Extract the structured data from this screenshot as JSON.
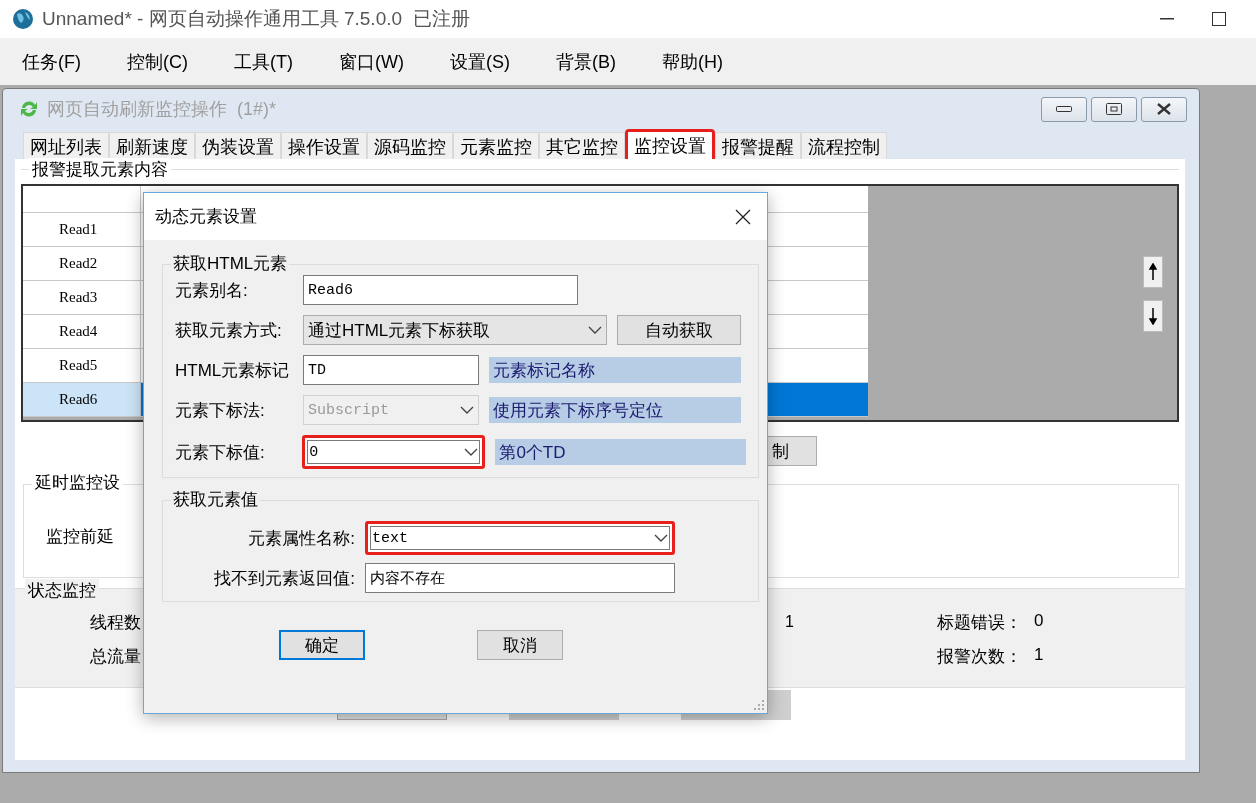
{
  "app": {
    "title": "Unnamed* - 网页自动操作通用工具 7.5.0.0  已注册"
  },
  "menu": [
    "任务(F)",
    "控制(C)",
    "工具(T)",
    "窗口(W)",
    "设置(S)",
    "背景(B)",
    "帮助(H)"
  ],
  "child_window": {
    "title": "网页自动刷新监控操作  (1#)*"
  },
  "tabs": [
    {
      "label": "网址列表",
      "selected": false,
      "highlighted": false
    },
    {
      "label": "刷新速度",
      "selected": false,
      "highlighted": false
    },
    {
      "label": "伪装设置",
      "selected": false,
      "highlighted": false
    },
    {
      "label": "操作设置",
      "selected": false,
      "highlighted": false
    },
    {
      "label": "源码监控",
      "selected": false,
      "highlighted": false
    },
    {
      "label": "元素监控",
      "selected": false,
      "highlighted": false
    },
    {
      "label": "其它监控",
      "selected": false,
      "highlighted": false
    },
    {
      "label": "监控设置",
      "selected": true,
      "highlighted": true
    },
    {
      "label": "报警提醒",
      "selected": false,
      "highlighted": false
    },
    {
      "label": "流程控制",
      "selected": false,
      "highlighted": false
    }
  ],
  "alert_group": {
    "title": "报警提取元素内容",
    "rows": [
      {
        "label": "Read1",
        "selected": false
      },
      {
        "label": "Read2",
        "selected": false
      },
      {
        "label": "Read3",
        "selected": false
      },
      {
        "label": "Read4",
        "selected": false
      },
      {
        "label": "Read5",
        "selected": false
      },
      {
        "label": "Read6",
        "selected": true
      }
    ]
  },
  "partial_button": "制",
  "delay_group": {
    "title": "延时监控设",
    "label": "监控前延"
  },
  "status_group": {
    "title": "状态监控",
    "labels": [
      "线程数",
      "总流量"
    ],
    "value": "1",
    "stats": [
      {
        "label": "标题错误：",
        "value": "0"
      },
      {
        "label": "报警次数：",
        "value": "1"
      }
    ]
  },
  "dialog": {
    "title": "动态元素设置",
    "groups": [
      {
        "title": "获取HTML元素",
        "fields": [
          {
            "kind": "input",
            "label": "元素别名:",
            "value": "Read6",
            "highlighted": false
          },
          {
            "kind": "select",
            "label": "获取元素方式:",
            "value": "通过HTML元素下标获取",
            "button": "自动获取",
            "highlighted": false
          },
          {
            "kind": "input",
            "label": "HTML元素标记",
            "value": "TD",
            "note": "元素标记名称",
            "highlighted": false
          },
          {
            "kind": "select",
            "label": "元素下标法:",
            "value": "Subscript",
            "note": "使用元素下标序号定位",
            "disabled": true,
            "highlighted": false
          },
          {
            "kind": "combo",
            "label": "元素下标值:",
            "value": "0",
            "note": "第0个TD",
            "highlighted": true
          }
        ]
      },
      {
        "title": "获取元素值",
        "fields": [
          {
            "kind": "combo",
            "label": "元素属性名称:",
            "value": "text",
            "highlighted": true
          },
          {
            "kind": "input",
            "label": "找不到元素返回值:",
            "value": "内容不存在",
            "highlighted": false
          }
        ]
      }
    ],
    "buttons": [
      {
        "label": "确定",
        "default": true
      },
      {
        "label": "取消",
        "default": false
      }
    ]
  }
}
